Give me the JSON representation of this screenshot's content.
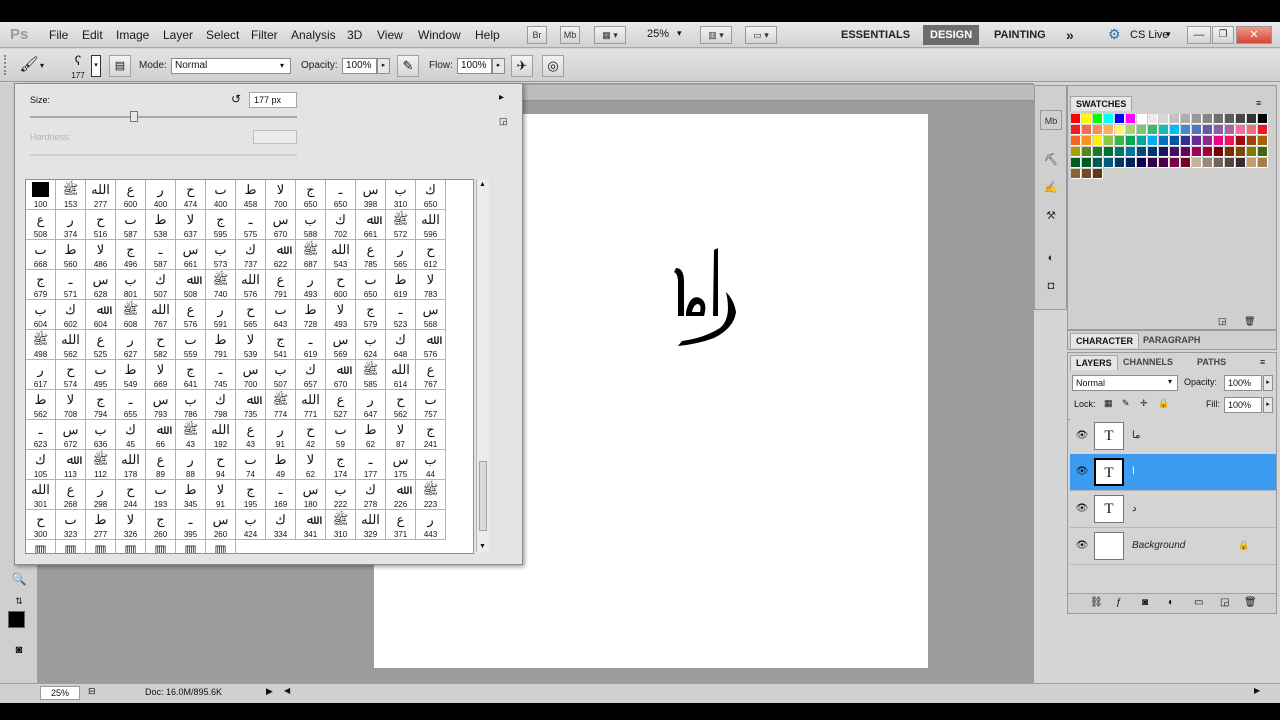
{
  "app": {
    "logo": "Ps"
  },
  "menu": [
    "File",
    "Edit",
    "Image",
    "Layer",
    "Select",
    "Filter",
    "Analysis",
    "3D",
    "View",
    "Window",
    "Help"
  ],
  "appbar": {
    "bridge_label": "Br",
    "minibridge_label": "Mb",
    "zoom": "25%"
  },
  "workspaces": [
    "ESSENTIALS",
    "DESIGN",
    "PAINTING"
  ],
  "more_workspaces": "»",
  "cslive": "CS Live",
  "options": {
    "brush_size": "177",
    "mode_label": "Mode:",
    "mode_value": "Normal",
    "opacity_label": "Opacity:",
    "opacity_value": "100%",
    "flow_label": "Flow:",
    "flow_value": "100%"
  },
  "brush_picker": {
    "size_label": "Size:",
    "size_value": "177 px",
    "size_fraction": 0.39,
    "hardness_label": "Hardness:",
    "brushes": [
      [
        "100",
        "153",
        "277",
        "600",
        "400",
        "474",
        "400",
        "458",
        "700",
        "650",
        "650",
        "398",
        "310",
        "650"
      ],
      [
        "508",
        "374",
        "516",
        "587",
        "538",
        "637",
        "595",
        "575",
        "670",
        "588",
        "702",
        "661",
        "572",
        "596"
      ],
      [
        "668",
        "560",
        "486",
        "496",
        "587",
        "661",
        "573",
        "737",
        "622",
        "687",
        "543",
        "785",
        "565",
        "612"
      ],
      [
        "679",
        "571",
        "628",
        "801",
        "507",
        "508",
        "740",
        "576",
        "791",
        "493",
        "600",
        "650",
        "619",
        "783"
      ],
      [
        "604",
        "602",
        "604",
        "608",
        "767",
        "576",
        "591",
        "565",
        "643",
        "728",
        "493",
        "579",
        "523",
        "568"
      ],
      [
        "498",
        "562",
        "525",
        "627",
        "582",
        "559",
        "791",
        "539",
        "541",
        "619",
        "569",
        "624",
        "648",
        "576"
      ],
      [
        "617",
        "574",
        "495",
        "549",
        "669",
        "641",
        "745",
        "700",
        "507",
        "657",
        "670",
        "585",
        "614",
        "767"
      ],
      [
        "562",
        "708",
        "794",
        "655",
        "793",
        "786",
        "798",
        "735",
        "774",
        "771",
        "527",
        "647",
        "562",
        "757"
      ],
      [
        "623",
        "672",
        "636",
        "45",
        "66",
        "43",
        "192",
        "43",
        "91",
        "42",
        "59",
        "62",
        "87",
        "241"
      ],
      [
        "105",
        "113",
        "112",
        "178",
        "89",
        "88",
        "94",
        "74",
        "49",
        "62",
        "174",
        "177",
        "175",
        "44"
      ],
      [
        "301",
        "268",
        "298",
        "244",
        "193",
        "345",
        "91",
        "195",
        "169",
        "180",
        "222",
        "278",
        "226",
        "223"
      ],
      [
        "300",
        "323",
        "277",
        "326",
        "260",
        "395",
        "260",
        "424",
        "334",
        "341",
        "310",
        "329",
        "371",
        "443"
      ]
    ]
  },
  "swatches": {
    "tab": "SWATCHES",
    "colors": [
      "#ff0000",
      "#ffff00",
      "#00ff00",
      "#00ffff",
      "#0000ff",
      "#ff00ff",
      "#ffffff",
      "#ebebeb",
      "#d6d6d6",
      "#c2c2c2",
      "#adadad",
      "#999999",
      "#858585",
      "#707070",
      "#5c5c5c",
      "#474747",
      "#333333",
      "#000000",
      "#ee1d24",
      "#f26c4f",
      "#f68e56",
      "#fbaf5d",
      "#fff467",
      "#acd372",
      "#7cc576",
      "#3bb878",
      "#1abbb4",
      "#00bff3",
      "#438ccb",
      "#5574b9",
      "#605ca8",
      "#855fa8",
      "#a763a8",
      "#f06ea9",
      "#f26d7d",
      "#ed1c24",
      "#f26522",
      "#f7941d",
      "#fff200",
      "#8dc63f",
      "#39b54a",
      "#00a651",
      "#00a99d",
      "#00aeef",
      "#0072bc",
      "#0054a6",
      "#2e3192",
      "#662d91",
      "#92278f",
      "#ec008c",
      "#ed145b",
      "#9e0b0f",
      "#a0410d",
      "#a36209",
      "#aba000",
      "#598527",
      "#1a7b30",
      "#007236",
      "#00746b",
      "#0076a3",
      "#004b80",
      "#003471",
      "#1b1464",
      "#440e62",
      "#630460",
      "#9e005d",
      "#9e0039",
      "#790000",
      "#7b2e00",
      "#7d4900",
      "#827b00",
      "#406618",
      "#005e20",
      "#005826",
      "#005952",
      "#005b7f",
      "#003663",
      "#002157",
      "#0d004c",
      "#32004b",
      "#4b0049",
      "#7b0046",
      "#7a0026",
      "#c7b299",
      "#998675",
      "#736357",
      "#534741",
      "#362f2d",
      "#c69c6d",
      "#a67c52",
      "#8c6239",
      "#754c24",
      "#603913"
    ]
  },
  "character_panel": {
    "tabs": [
      "CHARACTER",
      "PARAGRAPH"
    ]
  },
  "layers_panel": {
    "tabs": [
      "LAYERS",
      "CHANNELS",
      "PATHS"
    ],
    "blend_mode": "Normal",
    "opacity_label": "Opacity:",
    "opacity_value": "100%",
    "lock_label": "Lock:",
    "fill_label": "Fill:",
    "fill_value": "100%",
    "layers": [
      {
        "name": "ما",
        "thumb": "T"
      },
      {
        "name": "ا",
        "thumb": "T"
      },
      {
        "name": "د",
        "thumb": "T"
      },
      {
        "name": "Background",
        "thumb": ""
      }
    ]
  },
  "status": {
    "zoom": "25%",
    "doc": "Doc: 16.0M/895.6K"
  }
}
